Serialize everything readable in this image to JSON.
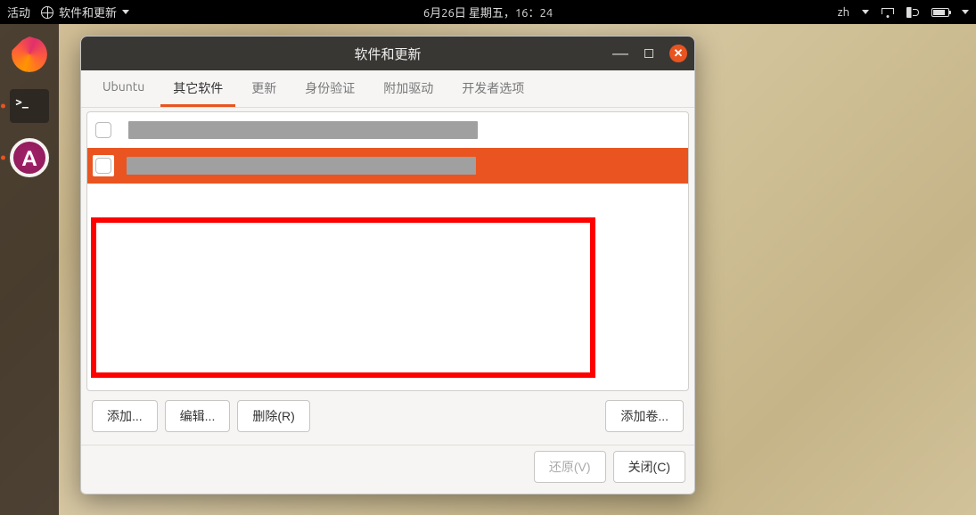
{
  "topbar": {
    "activities": "活动",
    "app_name": "软件和更新",
    "datetime": "6月26日 星期五，16：24",
    "input_method": "zh"
  },
  "window": {
    "title": "软件和更新"
  },
  "tabs": [
    {
      "label": "Ubuntu",
      "active": false
    },
    {
      "label": "其它软件",
      "active": true
    },
    {
      "label": "更新",
      "active": false
    },
    {
      "label": "身份验证",
      "active": false
    },
    {
      "label": "附加驱动",
      "active": false
    },
    {
      "label": "开发者选项",
      "active": false
    }
  ],
  "sources": [
    {
      "selected": false,
      "checked": false
    },
    {
      "selected": true,
      "checked": false
    }
  ],
  "buttons": {
    "add": "添加...",
    "edit": "编辑...",
    "remove": "删除(R)",
    "add_volume": "添加卷...",
    "revert": "还原(V)",
    "close": "关闭(C)"
  }
}
